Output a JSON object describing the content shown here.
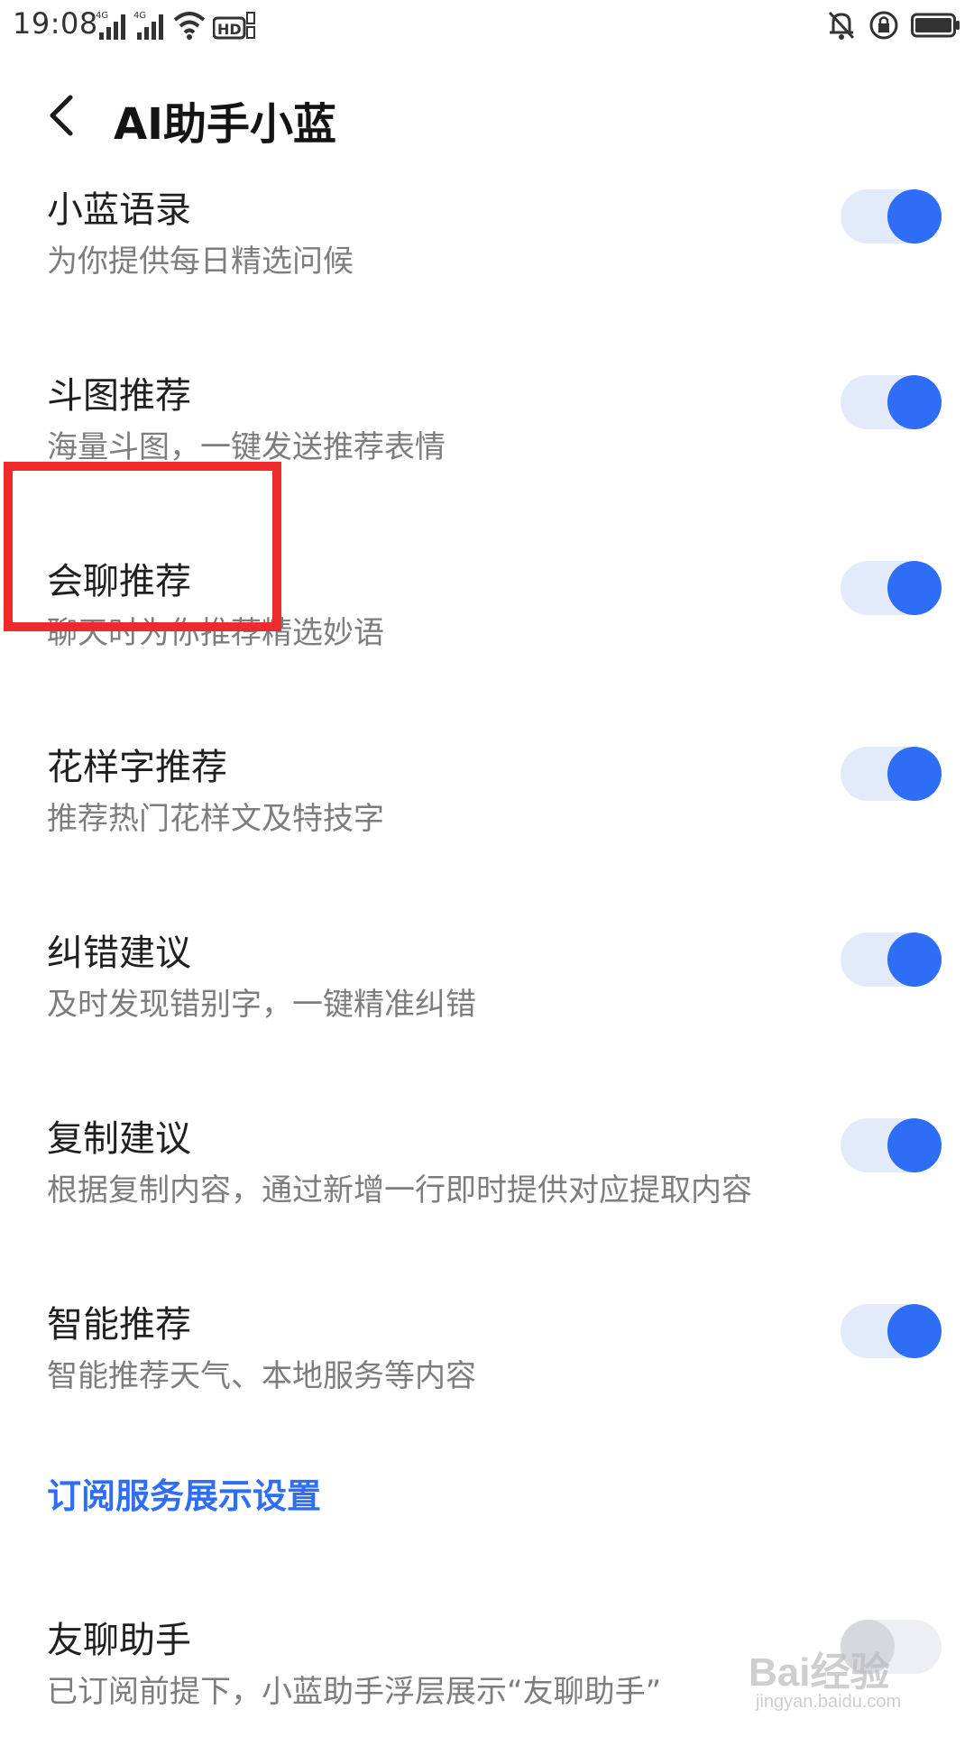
{
  "status_bar": {
    "time": "19:08",
    "network_1": "4G",
    "network_2": "4G",
    "hd_label": "HD",
    "icons": [
      "signal-icon",
      "wifi-icon",
      "hd-icon",
      "mute-icon",
      "rotation-lock-icon",
      "battery-icon"
    ]
  },
  "header": {
    "title": "AI助手小蓝",
    "back_icon": "chevron-left-icon"
  },
  "settings": [
    {
      "title": "小蓝语录",
      "desc": "为你提供每日精选问候",
      "on": true
    },
    {
      "title": "斗图推荐",
      "desc": "海量斗图，一键发送推荐表情",
      "on": true
    },
    {
      "title": "会聊推荐",
      "desc": "聊天时为你推荐精选妙语",
      "on": true
    },
    {
      "title": "花样字推荐",
      "desc": "推荐热门花样文及特技字",
      "on": true
    },
    {
      "title": "纠错建议",
      "desc": "及时发现错别字，一键精准纠错",
      "on": true
    },
    {
      "title": "复制建议",
      "desc": "根据复制内容，通过新增一行即时提供对应提取内容",
      "on": true
    },
    {
      "title": "智能推荐",
      "desc": "智能推荐天气、本地服务等内容",
      "on": true
    }
  ],
  "section_link": "订阅服务展示设置",
  "subscription_setting": {
    "title": "友聊助手",
    "desc": "已订阅前提下，小蓝助手浮层展示“友聊助手”",
    "on": false
  },
  "watermark": {
    "main": "Bai经验",
    "sub": "jingyan.baidu.com"
  },
  "colors": {
    "accent": "#2e6df6",
    "highlight": "#ee2a2a"
  }
}
